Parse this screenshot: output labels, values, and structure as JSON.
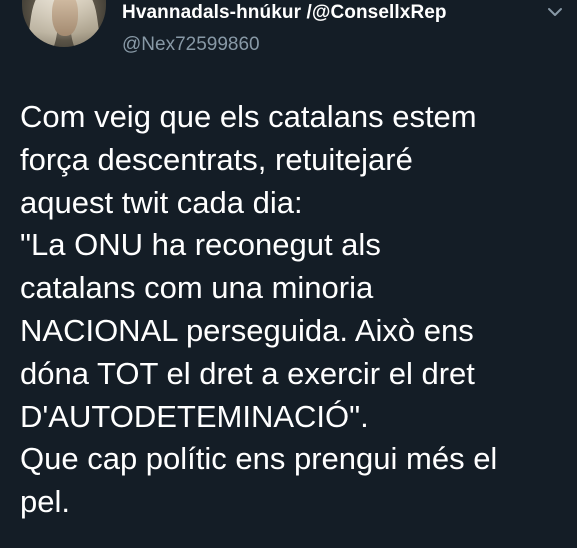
{
  "tweet": {
    "display_name": "Hvannadals-hnúkur /@ConsellxRep",
    "handle": "@Nex72599860",
    "text": "Com veig que els catalans estem\nforça descentrats, retuitejaré\naquest twit cada dia:\n\"La ONU ha reconegut als\ncatalans com una minoria\nNACIONAL perseguida. Això ens\ndóna TOT el dret a exercir el dret\nD'AUTODETEMINACIÓ\".\nQue cap polític ens prengui més el\npel."
  },
  "icons": {
    "menu": "chevron-down-icon",
    "avatar": "avatar"
  },
  "colors": {
    "background": "#141d26",
    "text": "#ffffff",
    "secondary_text": "#8899a6"
  }
}
